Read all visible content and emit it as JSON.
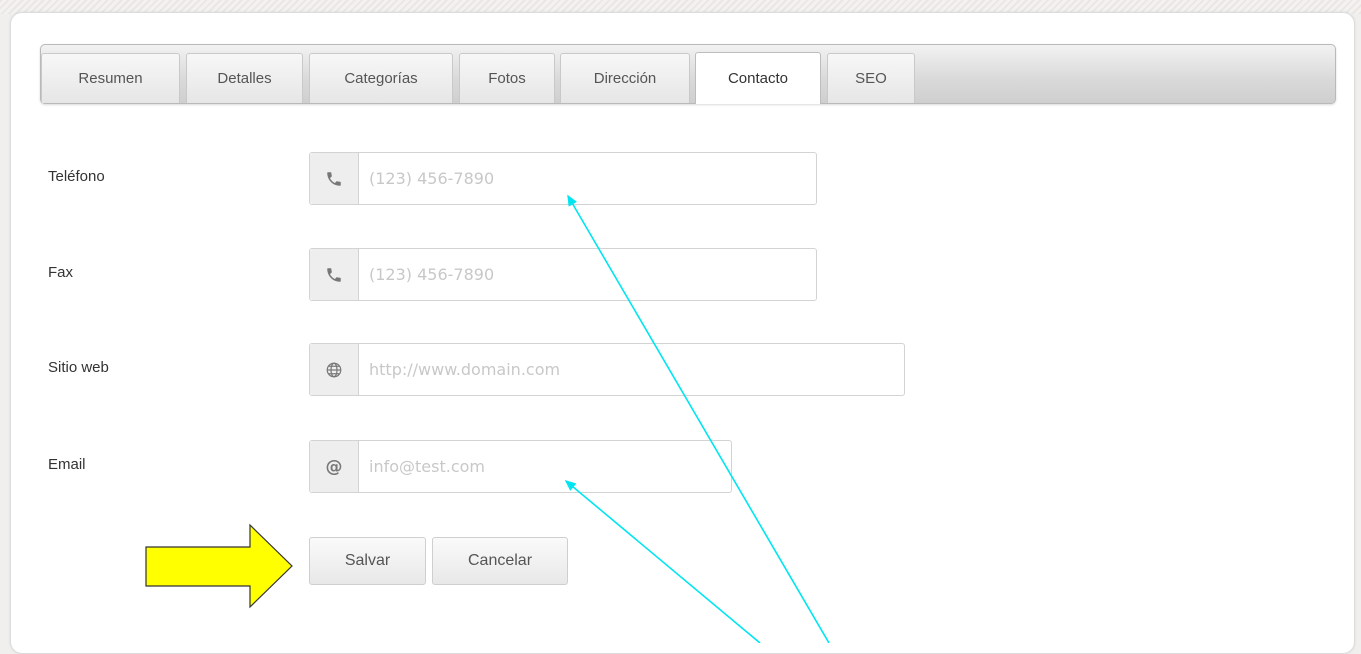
{
  "tabs": [
    {
      "label": "Resumen"
    },
    {
      "label": "Detalles"
    },
    {
      "label": "Categorías"
    },
    {
      "label": "Fotos"
    },
    {
      "label": "Dirección"
    },
    {
      "label": "Contacto",
      "active": true
    },
    {
      "label": "SEO"
    }
  ],
  "form": {
    "phone": {
      "label": "Teléfono",
      "placeholder": "(123) 456-7890",
      "value": "",
      "icon": "phone-icon"
    },
    "fax": {
      "label": "Fax",
      "placeholder": "(123) 456-7890",
      "value": "",
      "icon": "phone-icon"
    },
    "website": {
      "label": "Sitio web",
      "placeholder": "http://www.domain.com",
      "value": "",
      "icon": "globe-icon"
    },
    "email": {
      "label": "Email",
      "placeholder": "info@test.com",
      "value": "",
      "icon": "at-icon",
      "icon_glyph": "@"
    }
  },
  "buttons": {
    "save_label": "Salvar",
    "cancel_label": "Cancelar"
  },
  "annotations": {
    "arrow_color": "#00e5f0",
    "big_arrow_color": "#ffff00"
  }
}
